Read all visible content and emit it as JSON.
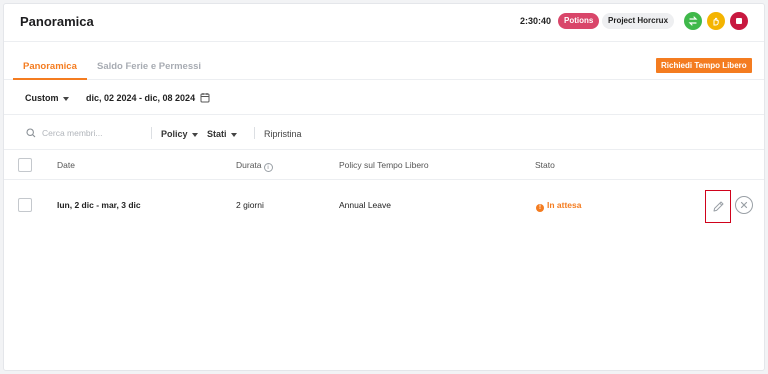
{
  "header": {
    "title": "Panoramica",
    "timer": "2:30:40",
    "tag_potions": "Potions",
    "tag_project": "Project Horcrux",
    "action_icons": [
      "swap-icon",
      "hand-icon",
      "stop-icon"
    ],
    "colors": {
      "green": "#3fb84a",
      "yellow": "#f4b400",
      "red": "#c8183f"
    }
  },
  "tabs": [
    {
      "label": "Panoramica",
      "active": true
    },
    {
      "label": "Saldo Ferie e Permessi",
      "active": false
    }
  ],
  "request_button": "Richiedi Tempo Libero",
  "range": {
    "mode": "Custom",
    "dates": "dic, 02 2024 - dic, 08 2024"
  },
  "filters": {
    "search_placeholder": "Cerca membri...",
    "policy": "Policy",
    "status": "Stati",
    "reset": "Ripristina"
  },
  "table": {
    "columns": {
      "date": "Date",
      "duration": "Durata",
      "policy": "Policy sul Tempo Libero",
      "status": "Stato"
    },
    "rows": [
      {
        "date": "lun, 2 dic - mar, 3 dic",
        "duration": "2 giorni",
        "policy": "Annual Leave",
        "status": "In attesa"
      }
    ]
  },
  "accent_color": "#f47c20"
}
